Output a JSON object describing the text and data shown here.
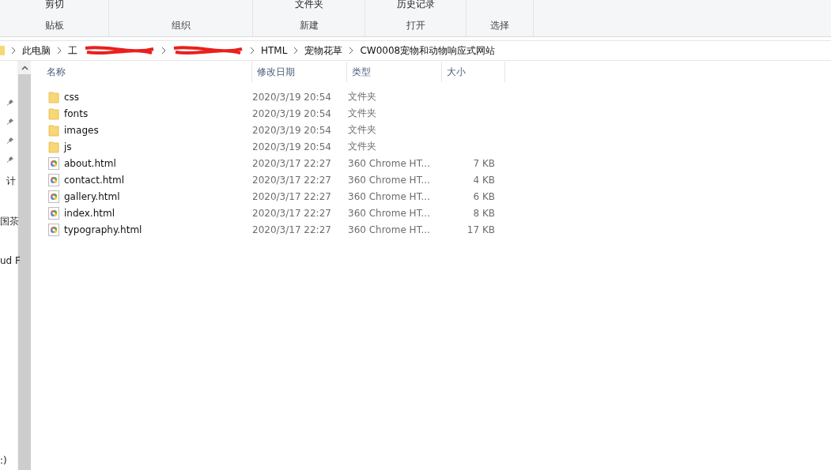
{
  "ribbon": {
    "groups": [
      {
        "top": "剪切",
        "label": "贴板"
      },
      {
        "label": "组织"
      },
      {
        "top": "文件夹",
        "label": "新建"
      },
      {
        "top": "历史记录",
        "label": "打开"
      },
      {
        "label": "选择"
      }
    ]
  },
  "address_bar": {
    "crumbs": [
      {
        "kind": "folder"
      },
      {
        "kind": "text",
        "text": "此电脑"
      },
      {
        "kind": "redacted",
        "text": "工"
      },
      {
        "kind": "redacted"
      },
      {
        "kind": "text",
        "text": "HTML"
      },
      {
        "kind": "text",
        "text": "宠物花草"
      },
      {
        "kind": "text",
        "text": "CW0008宠物和动物响应式网站"
      }
    ]
  },
  "nav_pane": {
    "items": [
      {
        "kind": "pin"
      },
      {
        "kind": "pin"
      },
      {
        "kind": "pin"
      },
      {
        "kind": "pin"
      },
      {
        "kind": "text",
        "text": "计"
      },
      {
        "kind": "text",
        "text": "国茶"
      },
      {
        "kind": "text",
        "text": "ud F"
      },
      {
        "kind": "text",
        "text": ":)"
      }
    ]
  },
  "table": {
    "columns": [
      "名称",
      "修改日期",
      "类型",
      "大小"
    ],
    "rows": [
      {
        "kind": "folder",
        "name": "css",
        "date": "2020/3/19 20:54",
        "type": "文件夹"
      },
      {
        "kind": "folder",
        "name": "fonts",
        "date": "2020/3/19 20:54",
        "type": "文件夹"
      },
      {
        "kind": "folder",
        "name": "images",
        "date": "2020/3/19 20:54",
        "type": "文件夹"
      },
      {
        "kind": "folder",
        "name": "js",
        "date": "2020/3/19 20:54",
        "type": "文件夹"
      },
      {
        "kind": "html",
        "name": "about.html",
        "date": "2020/3/17 22:27",
        "type": "360 Chrome HT...",
        "size": "7 KB"
      },
      {
        "kind": "html",
        "name": "contact.html",
        "date": "2020/3/17 22:27",
        "type": "360 Chrome HT...",
        "size": "4 KB"
      },
      {
        "kind": "html",
        "name": "gallery.html",
        "date": "2020/3/17 22:27",
        "type": "360 Chrome HT...",
        "size": "6 KB"
      },
      {
        "kind": "html",
        "name": "index.html",
        "date": "2020/3/17 22:27",
        "type": "360 Chrome HT...",
        "size": "8 KB"
      },
      {
        "kind": "html",
        "name": "typography.html",
        "date": "2020/3/17 22:27",
        "type": "360 Chrome HT...",
        "size": "17 KB"
      }
    ]
  }
}
